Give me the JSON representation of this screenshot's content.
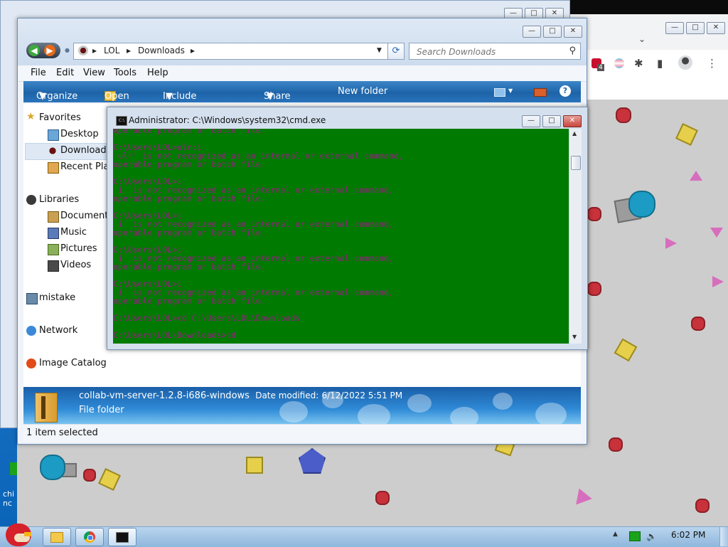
{
  "desktop": {
    "left_text": "chi\nnc",
    "left_number": "4"
  },
  "explorer": {
    "breadcrumb": [
      "LOL",
      "Downloads"
    ],
    "search_placeholder": "Search Downloads",
    "menu": [
      "File",
      "Edit",
      "View",
      "Tools",
      "Help"
    ],
    "toolbar": {
      "organize": "Organize",
      "open": "Open",
      "include": "Include in library",
      "share": "Share with",
      "new_folder": "New folder"
    },
    "nav": {
      "favorites": "Favorites",
      "desktop": "Desktop",
      "downloads": "Downloads",
      "recent": "Recent Plac",
      "libraries": "Libraries",
      "documents": "Documents",
      "music": "Music",
      "pictures": "Pictures",
      "videos": "Videos",
      "homegroup": "mistake",
      "network": "Network",
      "image_catalog": "Image Catalog"
    },
    "details": {
      "name": "collab-vm-server-1.2.8-i686-windows",
      "modified_label": "Date modified:",
      "modified_value": "6/12/2022 5:51 PM",
      "type": "File folder"
    },
    "status": "1 item selected"
  },
  "cmd": {
    "title": "Administrator: C:\\Windows\\system32\\cmd.exe",
    "lines": "operable program or batch file.\n\nC:\\Users\\LOL>ulr:i\n'ulr' is not recognized as an internal or external command,\noperable program or batch file.\n\nC:\\Users\\LOL>i\n'i' is not recognized as an internal or external command,\noperable program or batch file.\n\nC:\\Users\\LOL>i\n'i' is not recognized as an internal or external command,\noperable program or batch file.\n\nC:\\Users\\LOL>i\n'i' is not recognized as an internal or external command,\noperable program or batch file.\n\nC:\\Users\\LOL>i\n'i' is not recognized as an internal or external command,\noperable program or batch file.\n\nC:\\Users\\LOL>cd C:\\Users\\LOL\\Downloads\n\nC:\\Users\\LOL\\Downloads>cd"
  },
  "taskbar": {
    "clock": "6:02 PM"
  },
  "chrome": {
    "ext_badge": "4"
  },
  "colors": {
    "cmd_bg": "#007a00",
    "cmd_fg": "#9a1c86",
    "game_bg": "#cdcdcd",
    "taskbar": "#a9c8e6"
  }
}
